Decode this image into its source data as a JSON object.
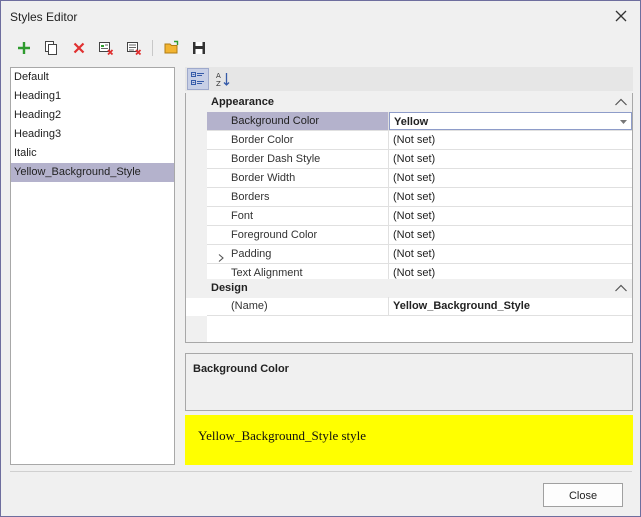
{
  "window": {
    "title": "Styles Editor"
  },
  "toolbar": {
    "buttons": [
      {
        "name": "add-style",
        "icon": "plus-icon"
      },
      {
        "name": "copy-style",
        "icon": "copy-icon"
      },
      {
        "name": "delete-style",
        "icon": "delete-icon"
      },
      {
        "name": "remove-unused",
        "icon": "clear-unused-icon"
      },
      {
        "name": "clear-all",
        "icon": "clear-all-icon"
      },
      {
        "name": "open-file",
        "icon": "folder-open-icon"
      },
      {
        "name": "save-file",
        "icon": "save-icon"
      }
    ]
  },
  "styles": {
    "items": [
      "Default",
      "Heading1",
      "Heading2",
      "Heading3",
      "Italic",
      "Yellow_Background_Style"
    ],
    "selected": "Yellow_Background_Style"
  },
  "property_grid": {
    "categories": [
      {
        "label": "Appearance",
        "rows": [
          {
            "name": "Background Color",
            "value": "Yellow"
          },
          {
            "name": "Border Color",
            "value": "(Not set)"
          },
          {
            "name": "Border Dash Style",
            "value": "(Not set)"
          },
          {
            "name": "Border Width",
            "value": "(Not set)"
          },
          {
            "name": "Borders",
            "value": "(Not set)"
          },
          {
            "name": "Font",
            "value": "(Not set)"
          },
          {
            "name": "Foreground Color",
            "value": "(Not set)"
          },
          {
            "name": "Padding",
            "value": "(Not set)"
          },
          {
            "name": "Text Alignment",
            "value": "(Not set)"
          }
        ]
      },
      {
        "label": "Design",
        "rows": [
          {
            "name": "(Name)",
            "value": "Yellow_Background_Style"
          }
        ]
      }
    ]
  },
  "description": {
    "title": "Background Color"
  },
  "preview": {
    "text": "Yellow_Background_Style style",
    "background": "#ffff00"
  },
  "footer": {
    "close_label": "Close"
  },
  "colors": {
    "selection": "#b4b2cc",
    "accent_green": "#2e9b2e",
    "accent_red": "#e03030"
  }
}
